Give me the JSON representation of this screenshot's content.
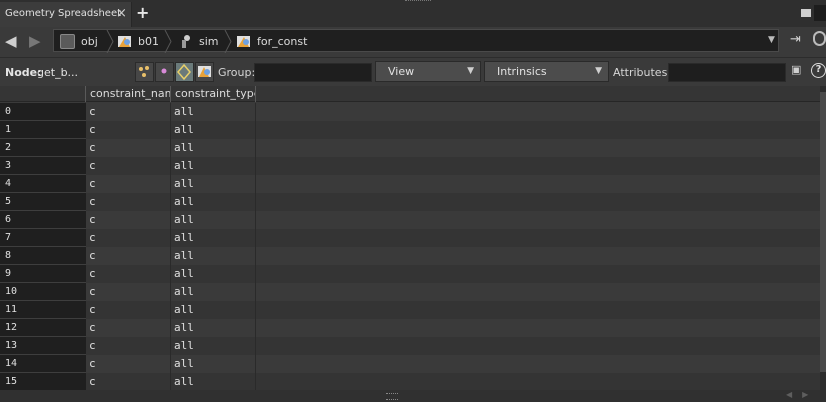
{
  "tab": {
    "title": "Geometry Spreadsheet",
    "close": "×",
    "add": "+"
  },
  "path": {
    "back": "◀",
    "forward": "▶",
    "crumbs": [
      {
        "label": "obj",
        "icon": "obj-network-icon"
      },
      {
        "label": "b01",
        "icon": "geo-node-icon"
      },
      {
        "label": "sim",
        "icon": "dop-network-icon"
      },
      {
        "label": "for_const",
        "icon": "geo-node-icon"
      }
    ]
  },
  "toolbar": {
    "node_label": "Node:",
    "node_value": "get_b...",
    "group_label": "Group:",
    "group_value": "",
    "view_label": "View",
    "intrinsics_label": "Intrinsics",
    "attributes_label": "Attributes:",
    "attributes_value": "",
    "help": "?"
  },
  "table": {
    "columns": [
      "",
      "constraint_nam",
      "constraint_type"
    ],
    "rows": [
      {
        "index": "0",
        "constraint_name": "c",
        "constraint_type": "all"
      },
      {
        "index": "1",
        "constraint_name": "c",
        "constraint_type": "all"
      },
      {
        "index": "2",
        "constraint_name": "c",
        "constraint_type": "all"
      },
      {
        "index": "3",
        "constraint_name": "c",
        "constraint_type": "all"
      },
      {
        "index": "4",
        "constraint_name": "c",
        "constraint_type": "all"
      },
      {
        "index": "5",
        "constraint_name": "c",
        "constraint_type": "all"
      },
      {
        "index": "6",
        "constraint_name": "c",
        "constraint_type": "all"
      },
      {
        "index": "7",
        "constraint_name": "c",
        "constraint_type": "all"
      },
      {
        "index": "8",
        "constraint_name": "c",
        "constraint_type": "all"
      },
      {
        "index": "9",
        "constraint_name": "c",
        "constraint_type": "all"
      },
      {
        "index": "10",
        "constraint_name": "c",
        "constraint_type": "all"
      },
      {
        "index": "11",
        "constraint_name": "c",
        "constraint_type": "all"
      },
      {
        "index": "12",
        "constraint_name": "c",
        "constraint_type": "all"
      },
      {
        "index": "13",
        "constraint_name": "c",
        "constraint_type": "all"
      },
      {
        "index": "14",
        "constraint_name": "c",
        "constraint_type": "all"
      },
      {
        "index": "15",
        "constraint_name": "c",
        "constraint_type": "all"
      }
    ]
  },
  "colors": {
    "panel_bg": "#3a3a3a",
    "row_alt": "#343434",
    "index_bg": "#1f1f1f",
    "field_bg": "#1e1e1e",
    "icon_orange": "#e8a23a",
    "icon_blue": "#6ea0e0"
  }
}
